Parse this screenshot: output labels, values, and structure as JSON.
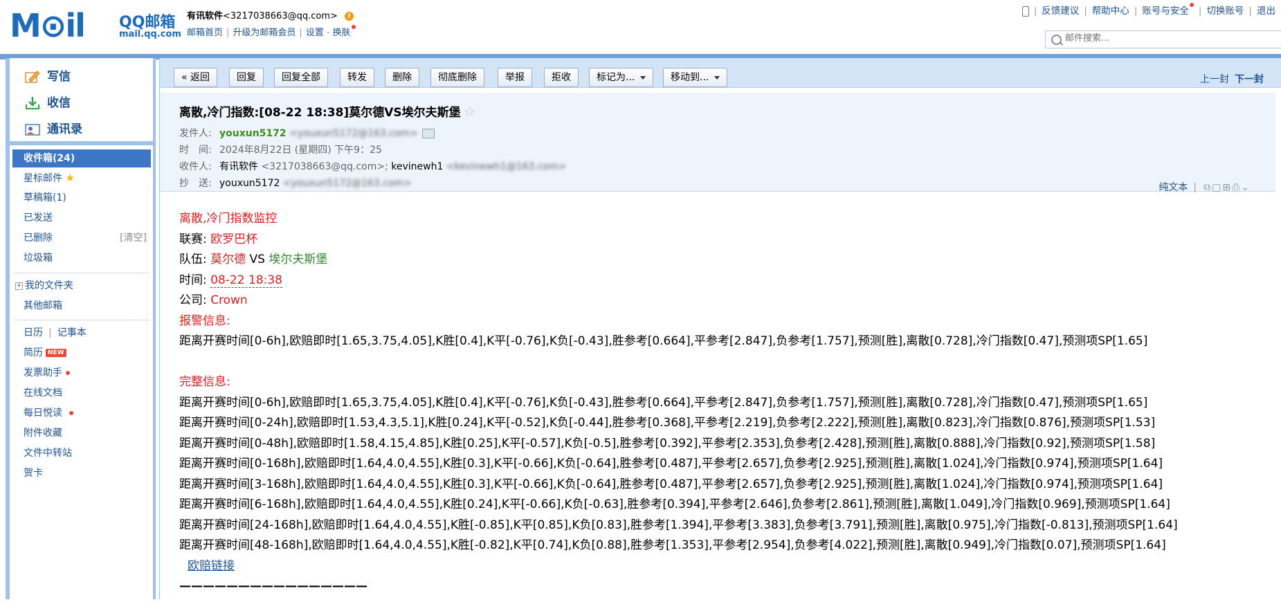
{
  "header": {
    "logo_big": "M⊙il",
    "logo_name": "QQ邮箱",
    "logo_url": "mail.qq.com",
    "account_name": "有讯软件",
    "account_email": "<3217038663@qq.com>",
    "links": [
      "邮箱首页",
      "升级为邮箱会员",
      "设置",
      "换肤"
    ],
    "top_right": [
      "反馈建议",
      "帮助中心",
      "账号与安全",
      "切换账号",
      "退出"
    ],
    "search_placeholder": "邮件搜索..."
  },
  "leftnav": {
    "quick": [
      "写信",
      "收信",
      "通讯录"
    ],
    "folders": {
      "inbox": "收件箱(24)",
      "starred": "星标邮件",
      "drafts": "草稿箱(1)",
      "sent": "已发送",
      "deleted": "已删除",
      "clear": "[清空]",
      "junk": "垃圾箱",
      "my_folders": "我的文件夹",
      "other": "其他邮箱"
    },
    "tools": {
      "calendar": "日历",
      "notes": "记事本",
      "resume": "简历",
      "resume_badge": "NEW",
      "invoice": "发票助手",
      "docs": "在线文档",
      "daily": "每日悦读",
      "attachments": "附件收藏",
      "transfer": "文件中转站",
      "cards": "贺卡"
    }
  },
  "toolbar": {
    "back": "« 返回",
    "reply": "回复",
    "reply_all": "回复全部",
    "forward": "转发",
    "delete": "删除",
    "delete_perm": "彻底删除",
    "report": "举报",
    "reject": "拒收",
    "mark_as": "标记为...",
    "move_to": "移动到...",
    "prev": "上一封",
    "next": "下一封"
  },
  "mail": {
    "subject": "离散,冷门指数:[08-22 18:38]莫尔德VS埃尔夫斯堡",
    "from_label": "发件人:",
    "from_name": "youxun5172",
    "from_addr": "<youxun5172@163.com>",
    "time_label": "时　间:",
    "time_value": "2024年8月22日 (星期四) 下午9：25",
    "to_label": "收件人:",
    "to_name1": "有讯软件",
    "to_addr1": "<3217038663@qq.com>;",
    "to_name2": "kevinewh1",
    "to_addr2": "<kevinewh1@163.com>",
    "cc_label": "抄　送:",
    "cc_name": "youxun5172",
    "cc_addr": "<youxun5172@163.com>",
    "plain_text": "纯文本"
  },
  "body": {
    "title": "离散,冷门指数监控",
    "league_label": "联赛:",
    "league": "欧罗巴杯",
    "team_label": "队伍:",
    "team_home": "莫尔德",
    "vs": "VS",
    "team_away": "埃尔夫斯堡",
    "time_label": "时间:",
    "time": "08-22 18:38",
    "company_label": "公司:",
    "company": "Crown",
    "alert_label": "报警信息:",
    "alert_line": "距离开赛时间[0-6h],欧赔即时[1.65,3.75,4.05],K胜[0.4],K平[-0.76],K负[-0.43],胜参考[0.664],平参考[2.847],负参考[1.757],预测[胜],离散[0.728],冷门指数[0.47],预测项SP[1.65]",
    "full_label": "完整信息:",
    "full_lines": [
      "距离开赛时间[0-6h],欧赔即时[1.65,3.75,4.05],K胜[0.4],K平[-0.76],K负[-0.43],胜参考[0.664],平参考[2.847],负参考[1.757],预测[胜],离散[0.728],冷门指数[0.47],预测项SP[1.65]",
      "距离开赛时间[0-24h],欧赔即时[1.53,4.3,5.1],K胜[0.24],K平[-0.52],K负[-0.44],胜参考[0.368],平参考[2.219],负参考[2.222],预测[胜],离散[0.823],冷门指数[0.876],预测项SP[1.53]",
      "距离开赛时间[0-48h],欧赔即时[1.58,4.15,4.85],K胜[0.25],K平[-0.57],K负[-0.5],胜参考[0.392],平参考[2.353],负参考[2.428],预测[胜],离散[0.888],冷门指数[0.92],预测项SP[1.58]",
      "距离开赛时间[0-168h],欧赔即时[1.64,4.0,4.55],K胜[0.3],K平[-0.66],K负[-0.64],胜参考[0.487],平参考[2.657],负参考[2.925],预测[胜],离散[1.024],冷门指数[0.974],预测项SP[1.64]",
      "距离开赛时间[3-168h],欧赔即时[1.64,4.0,4.55],K胜[0.3],K平[-0.66],K负[-0.64],胜参考[0.487],平参考[2.657],负参考[2.925],预测[胜],离散[1.024],冷门指数[0.974],预测项SP[1.64]",
      "距离开赛时间[6-168h],欧赔即时[1.64,4.0,4.55],K胜[0.24],K平[-0.66],K负[-0.63],胜参考[0.394],平参考[2.646],负参考[2.861],预测[胜],离散[1.049],冷门指数[0.969],预测项SP[1.64]",
      "距离开赛时间[24-168h],欧赔即时[1.64,4.0,4.55],K胜[-0.85],K平[0.85],K负[0.83],胜参考[1.394],平参考[3.383],负参考[3.791],预测[胜],离散[0.975],冷门指数[-0.813],预测项SP[1.64]",
      "距离开赛时间[48-168h],欧赔即时[1.64,4.0,4.55],K胜[-0.82],K平[0.74],K负[0.88],胜参考[1.353],平参考[2.954],负参考[4.022],预测[胜],离散[0.949],冷门指数[0.07],预测项SP[1.64]"
    ],
    "odds_link": "欧赔链接",
    "separator": "————————————————"
  },
  "colors": {
    "accent": "#1e5494",
    "nav_bg": "#9fc1ea",
    "active_folder": "#3b77c4",
    "alert_red": "#e02020"
  }
}
